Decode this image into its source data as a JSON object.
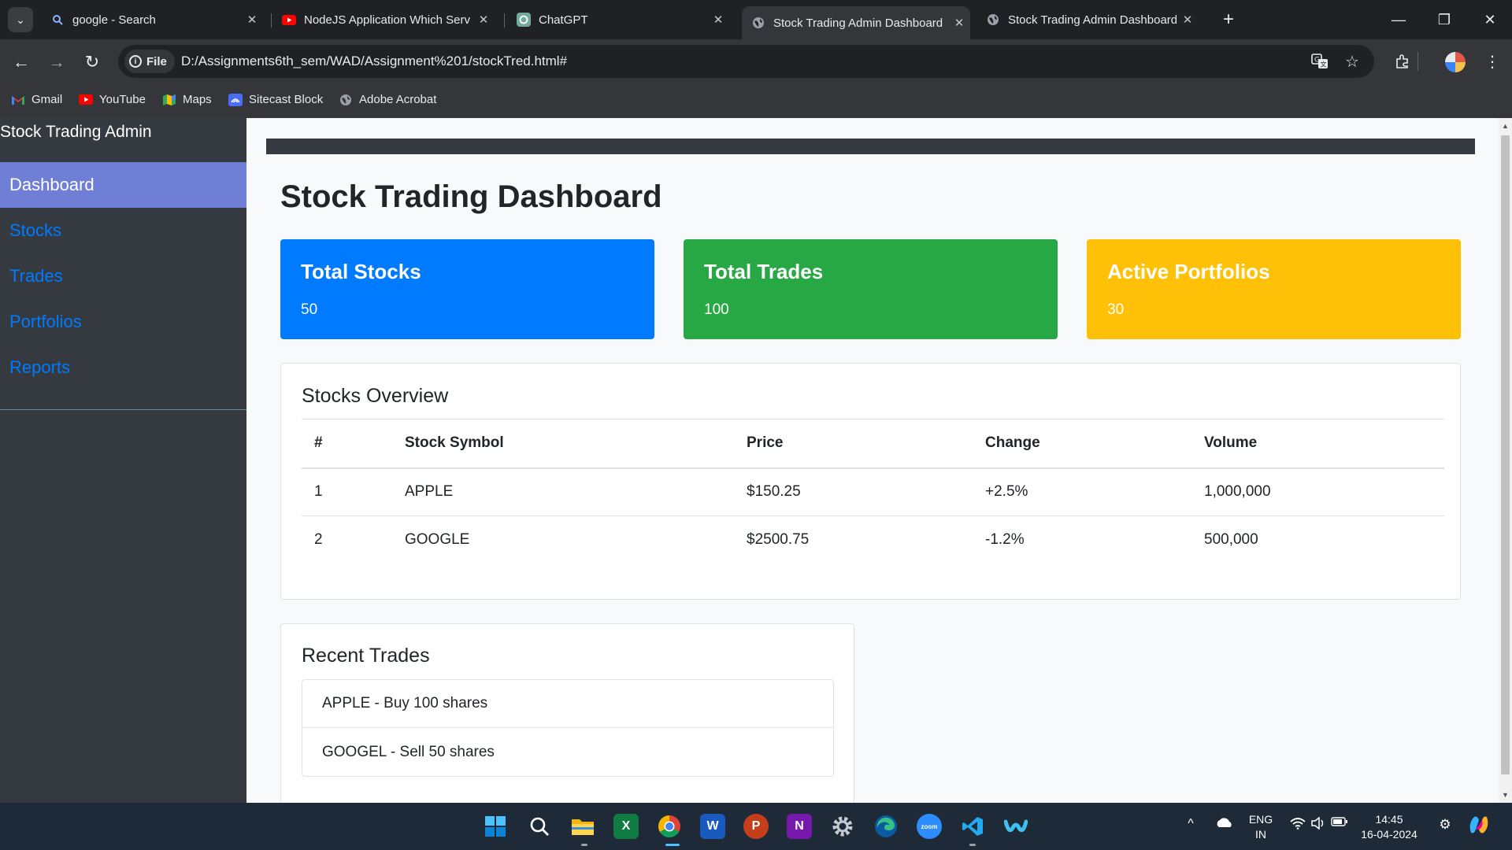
{
  "browser": {
    "tabs": [
      {
        "title": "google - Search",
        "icon": "search-icon"
      },
      {
        "title": "NodeJS Application Which Serv",
        "icon": "youtube-icon"
      },
      {
        "title": "ChatGPT",
        "icon": "chatgpt-icon"
      },
      {
        "title": "Stock Trading Admin Dashboard",
        "icon": "globe-icon",
        "active": true
      },
      {
        "title": "Stock Trading Admin Dashboard",
        "icon": "globe-icon"
      }
    ],
    "file_label": "File",
    "url": "D:/Assignments6th_sem/WAD/Assignment%201/stockTred.html#",
    "bookmarks": [
      {
        "label": "Gmail",
        "icon": "gmail-icon"
      },
      {
        "label": "YouTube",
        "icon": "youtube-icon"
      },
      {
        "label": "Maps",
        "icon": "maps-icon"
      },
      {
        "label": "Sitecast Block",
        "icon": "sitecast-icon"
      },
      {
        "label": "Adobe Acrobat",
        "icon": "globe-icon"
      }
    ]
  },
  "sidebar": {
    "brand": "Stock Trading Admin",
    "items": [
      {
        "label": "Dashboard",
        "active": true
      },
      {
        "label": "Stocks"
      },
      {
        "label": "Trades"
      },
      {
        "label": "Portfolios"
      },
      {
        "label": "Reports"
      }
    ]
  },
  "main": {
    "title": "Stock Trading Dashboard",
    "cards": [
      {
        "title": "Total Stocks",
        "value": "50",
        "color": "#007bff"
      },
      {
        "title": "Total Trades",
        "value": "100",
        "color": "#28a745"
      },
      {
        "title": "Active Portfolios",
        "value": "30",
        "color": "#ffc107"
      }
    ],
    "stocks_overview": {
      "title": "Stocks Overview",
      "headers": [
        "#",
        "Stock Symbol",
        "Price",
        "Change",
        "Volume"
      ],
      "rows": [
        [
          "1",
          "APPLE",
          "$150.25",
          "+2.5%",
          "1,000,000"
        ],
        [
          "2",
          "GOOGLE",
          "$2500.75",
          "-1.2%",
          "500,000"
        ]
      ]
    },
    "recent_trades": {
      "title": "Recent Trades",
      "items": [
        "APPLE - Buy 100 shares",
        "GOOGEL - Sell 50 shares"
      ]
    }
  },
  "taskbar": {
    "apps": [
      "windows-start-icon",
      "search-icon",
      "file-explorer-icon",
      "excel-icon",
      "chrome-icon",
      "word-icon",
      "powerpoint-icon",
      "onenote-icon",
      "settings-icon",
      "edge-icon",
      "zoom-icon",
      "vscode-icon",
      "webex-icon"
    ],
    "lang_line1": "ENG",
    "lang_line2": "IN",
    "time": "14:45",
    "date": "16-04-2024"
  }
}
